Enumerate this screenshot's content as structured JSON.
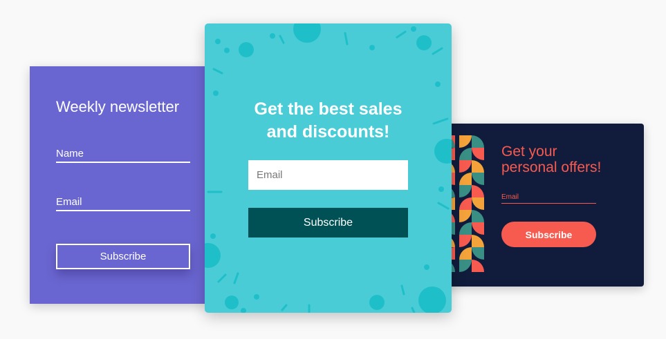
{
  "newsletter_card": {
    "title": "Weekly newsletter",
    "name_label": "Name",
    "email_label": "Email",
    "subscribe_label": "Subscribe"
  },
  "sales_card": {
    "headline_line1": "Get the best sales",
    "headline_line2": "and discounts!",
    "email_placeholder": "Email",
    "subscribe_label": "Subscribe"
  },
  "offers_card": {
    "title_line1": "Get your",
    "title_line2": "personal offers!",
    "email_label": "Email",
    "subscribe_label": "Subscribe"
  },
  "colors": {
    "purple": "#6a66d1",
    "teal": "#49ccd6",
    "teal_dark": "#005155",
    "navy": "#111c3c",
    "coral": "#f75a4f"
  }
}
